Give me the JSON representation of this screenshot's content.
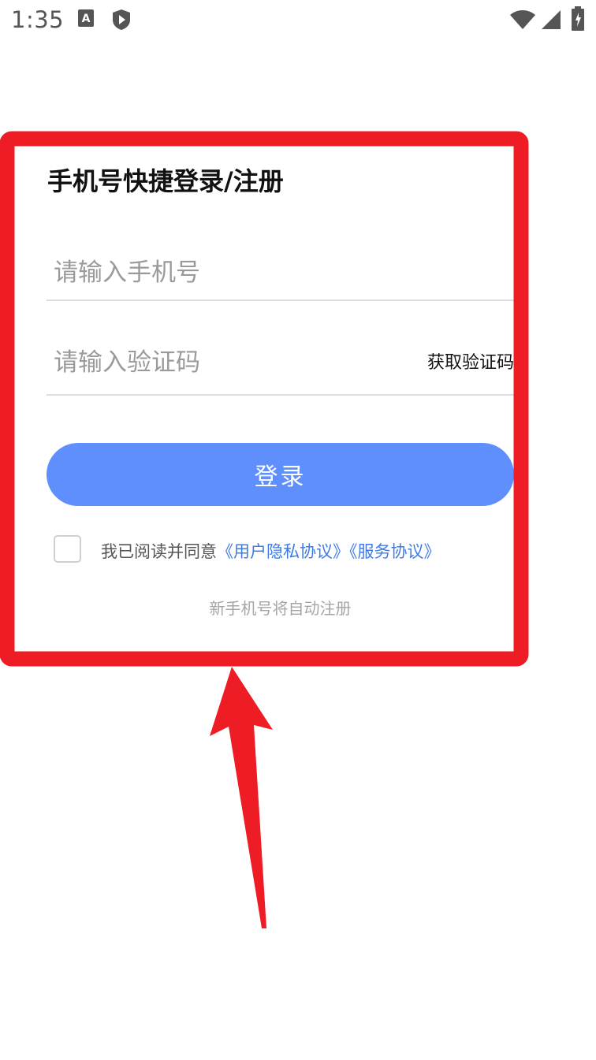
{
  "status_bar": {
    "time": "1:35",
    "icons": [
      "a-icon",
      "play-shield-icon",
      "wifi-icon",
      "signal-icon",
      "battery-icon"
    ]
  },
  "login": {
    "title": "手机号快捷登录/注册",
    "phone_placeholder": "请输入手机号",
    "phone_value": "",
    "code_placeholder": "请输入验证码",
    "code_value": "",
    "get_code_label": "获取验证码",
    "login_button_label": "登录",
    "agree_prefix": "我已阅读并同意",
    "privacy_link": "《用户隐私协议》",
    "service_link": "《服务协议》",
    "checkbox_checked": false,
    "auto_register_note": "新手机号将自动注册"
  },
  "colors": {
    "accent": "#5f8ffc",
    "link": "#3f7be6",
    "annotation": "#ee1c25"
  }
}
